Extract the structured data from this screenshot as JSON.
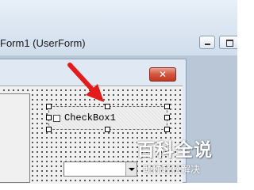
{
  "window": {
    "title": "Form1 (UserForm)",
    "minimize_icon": "minimize-icon",
    "restore_icon": "restore-icon"
  },
  "form": {
    "close_label": "✕",
    "close_icon": "close-icon"
  },
  "controls": {
    "checkbox_label": "CheckBox1",
    "combo_arrow_icon": "chevron-down-icon"
  },
  "annotation": {
    "arrow_color": "#e31b1b"
  },
  "watermark": {
    "brand": "百科全说",
    "tagline": "助你轻松解决"
  },
  "colors": {
    "title_bar": "#dbe6f2",
    "close_red": "#c03a22",
    "form_background": "#f0f0f0"
  }
}
